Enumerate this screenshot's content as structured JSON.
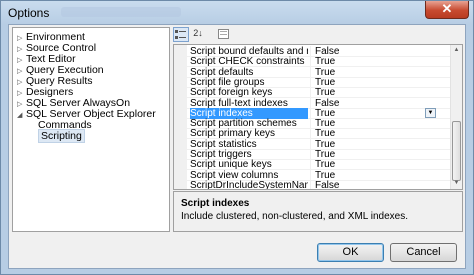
{
  "window": {
    "title": "Options",
    "close_glyph": "✕",
    "icons": {
      "close": "close-icon"
    }
  },
  "tree": {
    "items": [
      {
        "label": "Environment",
        "expander": "▷"
      },
      {
        "label": "Source Control",
        "expander": "▷"
      },
      {
        "label": "Text Editor",
        "expander": "▷"
      },
      {
        "label": "Query Execution",
        "expander": "▷"
      },
      {
        "label": "Query Results",
        "expander": "▷"
      },
      {
        "label": "Designers",
        "expander": "▷"
      },
      {
        "label": "SQL Server AlwaysOn",
        "expander": "▷"
      },
      {
        "label": "SQL Server Object Explorer",
        "expander": "◢"
      },
      {
        "label": "Commands",
        "expander": ""
      },
      {
        "label": "Scripting",
        "expander": ""
      }
    ],
    "selected": "Scripting"
  },
  "toolbar": {
    "categorized_icon": "categorized-icon",
    "alphabetical_icon": "alphabetical-icon",
    "alphabetical_glyph": "2↓",
    "property_pages_icon": "property-pages-icon"
  },
  "grid": {
    "rows": [
      {
        "name": "Script bound defaults and rules",
        "value": "False"
      },
      {
        "name": "Script CHECK constraints",
        "value": "True"
      },
      {
        "name": "Script defaults",
        "value": "True"
      },
      {
        "name": "Script file groups",
        "value": "True"
      },
      {
        "name": "Script foreign keys",
        "value": "True"
      },
      {
        "name": "Script full-text indexes",
        "value": "False"
      },
      {
        "name": "Script indexes",
        "value": "True"
      },
      {
        "name": "Script partition schemes",
        "value": "True"
      },
      {
        "name": "Script primary keys",
        "value": "True"
      },
      {
        "name": "Script statistics",
        "value": "True"
      },
      {
        "name": "Script triggers",
        "value": "True"
      },
      {
        "name": "Script unique keys",
        "value": "True"
      },
      {
        "name": "Script view columns",
        "value": "True"
      },
      {
        "name": "ScriptDrIncludeSystemNames",
        "value": "False"
      }
    ],
    "selected_index": 6,
    "dropdown_glyph": "▼",
    "scroll_up_glyph": "▲",
    "scroll_down_glyph": "▼"
  },
  "description": {
    "title": "Script indexes",
    "text": "Include clustered, non-clustered, and XML indexes."
  },
  "buttons": {
    "ok": "OK",
    "cancel": "Cancel"
  }
}
